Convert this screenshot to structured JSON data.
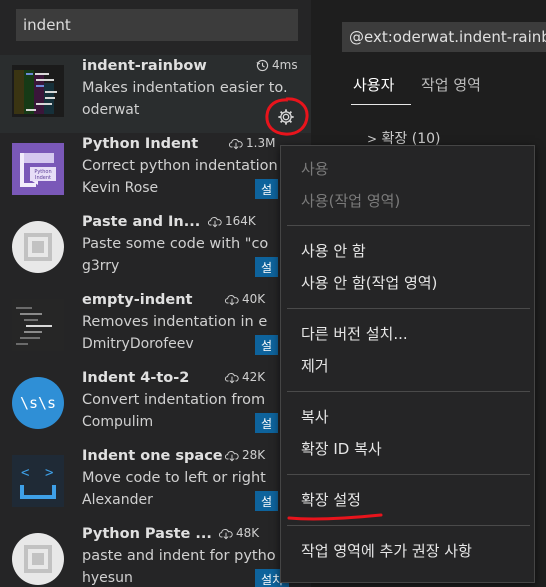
{
  "sidebar": {
    "search_value": "indent",
    "extensions": [
      {
        "name": "indent-rainbow",
        "stat": "4ms",
        "stat_icon": "history-icon",
        "description": "Makes indentation easier to...",
        "author": "oderwat",
        "install_label": ""
      },
      {
        "name": "Python Indent",
        "stat": "1.3M",
        "stat_icon": "download-icon",
        "description": "Correct python indentation",
        "author": "Kevin Rose",
        "install_label": "설"
      },
      {
        "name": "Paste and In...",
        "stat": "164K",
        "stat_icon": "download-icon",
        "description": "Paste some code with \"co",
        "author": "g3rry",
        "install_label": "설"
      },
      {
        "name": "empty-indent",
        "stat": "40K",
        "stat_icon": "download-icon",
        "description": "Removes indentation in e",
        "author": "DmitryDorofeev",
        "install_label": "설"
      },
      {
        "name": "Indent 4-to-2",
        "stat": "42K",
        "stat_icon": "download-icon",
        "description": "Convert indentation from",
        "author": "Compulim",
        "install_label": "설"
      },
      {
        "name": "Indent one space",
        "stat": "28K",
        "stat_icon": "download-icon",
        "description": "Move code to left or right",
        "author": "Alexander",
        "install_label": "설"
      },
      {
        "name": "Python Paste ...",
        "stat": "48K",
        "stat_icon": "download-icon",
        "description": "paste and indent for pytho",
        "author": "hyesun",
        "install_label": "설치"
      }
    ],
    "icon_texts": {
      "python_indent": "Python\nIndent",
      "indent42": "\\s\\s"
    }
  },
  "detail": {
    "search_value": "@ext:oderwat.indent-rainbow",
    "tabs": [
      "사용자",
      "작업 영역"
    ],
    "tree_label": "확장 (10)"
  },
  "context_menu": {
    "items": [
      {
        "label": "사용",
        "disabled": true
      },
      {
        "label": "사용(작업 영역)",
        "disabled": true
      },
      {
        "label": "사용 안 함",
        "disabled": false
      },
      {
        "label": "사용 안 함(작업 영역)",
        "disabled": false
      },
      {
        "label": "다른 버전 설치...",
        "disabled": false
      },
      {
        "label": "제거",
        "disabled": false
      },
      {
        "label": "복사",
        "disabled": false
      },
      {
        "label": "확장 ID 복사",
        "disabled": false
      },
      {
        "label": "확장 설정",
        "disabled": false
      },
      {
        "label": "작업 영역에 추가 권장 사항",
        "disabled": false
      }
    ]
  },
  "colors": {
    "accent_install": "#0e639c",
    "annotation_red": "#e8141c"
  }
}
